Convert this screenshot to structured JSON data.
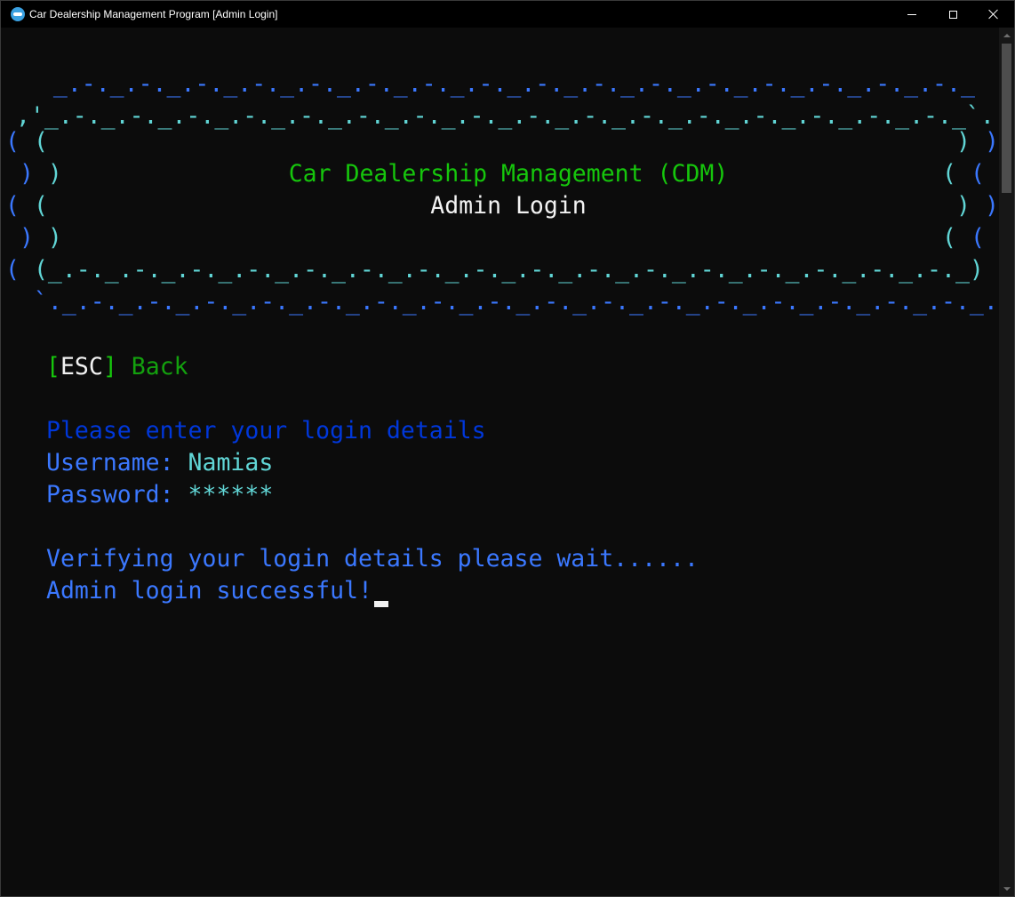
{
  "window": {
    "title": "Car Dealership Management Program [Admin Login]",
    "icon": "console-app-icon"
  },
  "banner": {
    "border_top_1": "   _.-._.-._.-._.-._.-._.-._.-._.-._.-._.-._.-._.-._.-._.-._.-._.-._",
    "border_top_2": " ,'_.-._.-._.-._.-._.-._.-._.-._.-._.-._.-._.-._.-._.-._.-._.-._.-._`.",
    "left_a": "( (",
    "left_b": " ) )",
    "right_a": ") )",
    "right_b": "( (",
    "border_bottom_left": "( (_.-._.-._.-._.-._.-._.-._.-._.-._.-._.-._.-._.-._.-._.-._.-._.-._) )",
    "border_bottom_2": "  `._.-._.-._.-._.-._.-._.-._.-._.-._.-._.-._.-._.-._.-._.-._.-._.-._.'",
    "title": "Car Dealership Management (CDM)",
    "subtitle": "Admin Login"
  },
  "menu": {
    "esc_open": "[",
    "esc_key": "ESC",
    "esc_close": "]",
    "back_label": "Back"
  },
  "form": {
    "prompt": "Please enter your login details",
    "username_label": "Username: ",
    "username_value": "Namias",
    "password_label": "Password: ",
    "password_value": "******"
  },
  "status": {
    "verifying": "Verifying your login details please wait......",
    "result": "Admin login successful!"
  },
  "colors": {
    "background": "#0c0c0c",
    "blue": "#3b78ff",
    "dark_blue": "#0037da",
    "cyan": "#61d6d6",
    "green": "#16c60c",
    "white": "#f2f2f2"
  }
}
